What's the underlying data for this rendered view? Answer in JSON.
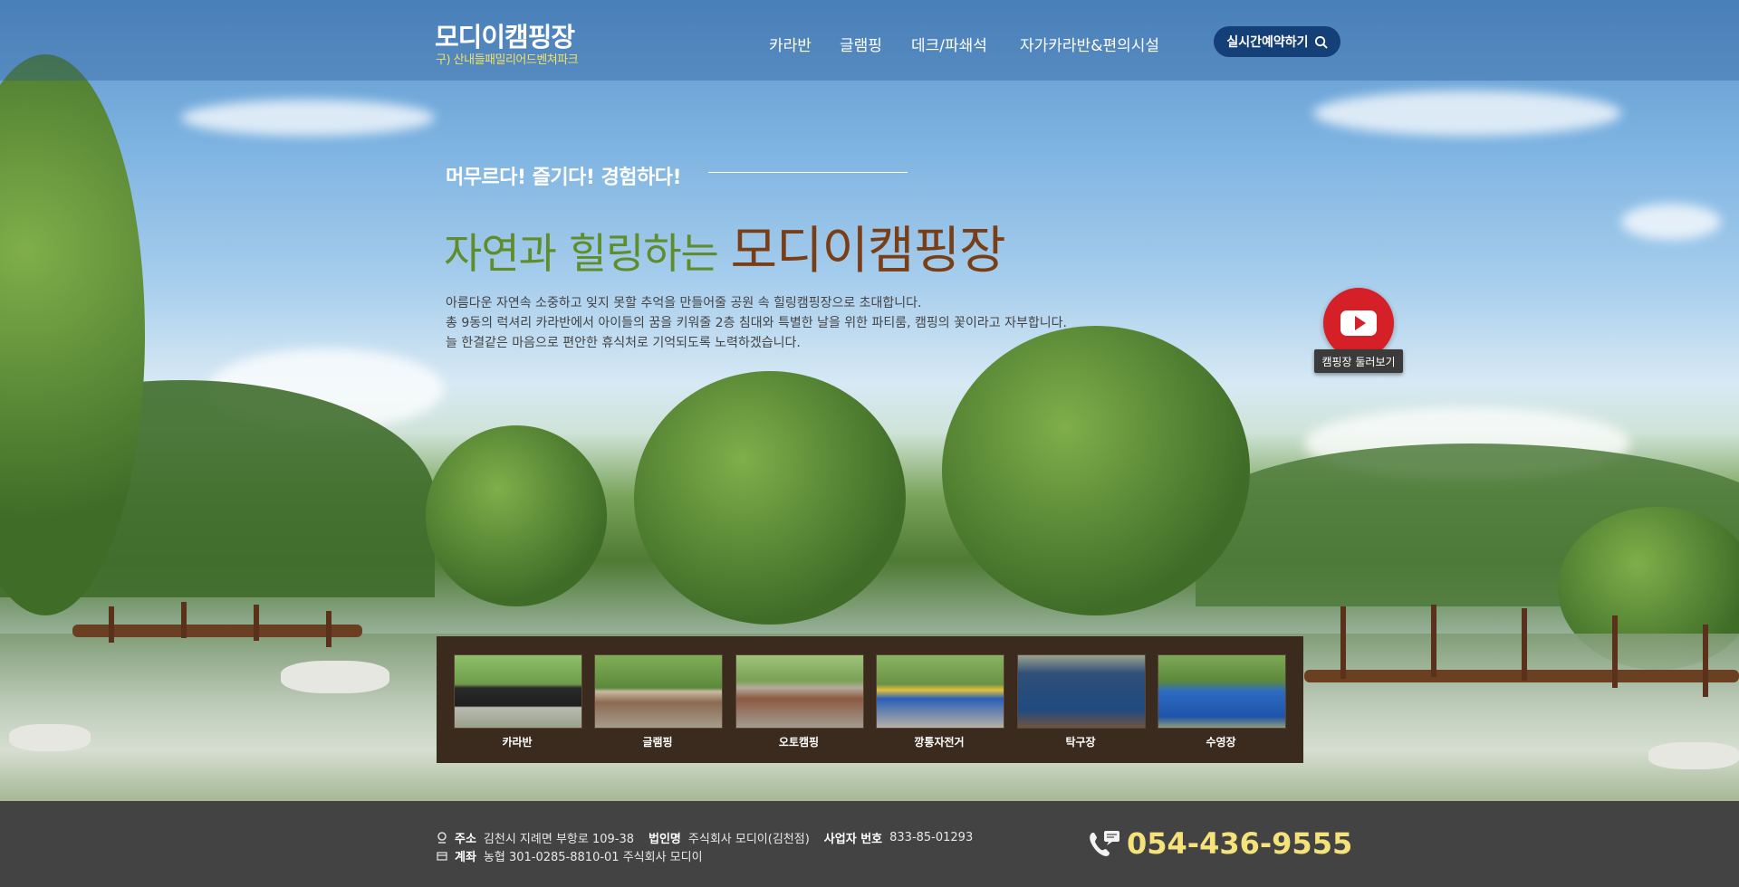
{
  "header": {
    "logo_title": "모디이캠핑장",
    "logo_sub": "구) 산내들패밀리어드벤쳐파크",
    "nav": [
      "카라반",
      "글램핑",
      "데크/파쇄석",
      "자가카라반&편의시설"
    ],
    "reserve_label": "실시간예약하기"
  },
  "intro": {
    "slogan": "머무르다! 즐기다! 경험하다!",
    "title_part1": "자연과 힐링하는",
    "title_part2": "모디이캠핑장",
    "desc_lines": [
      "아름다운 자연속 소중하고 잊지 못할 추억을 만들어줄 공원 속 힐링캠핑장으로 초대합니다.",
      "총 9동의 럭셔리 카라반에서 아이들의 꿈을 키워줄 2층 침대와 특별한 날을 위한 파티룸, 캠핑의 꽃이라고 자부합니다.",
      "늘 한결같은 마음으로 편안한 휴식처로 기억되도록 노력하겠습니다."
    ]
  },
  "video": {
    "label": "캠핑장 둘러보기"
  },
  "facilities": [
    {
      "label": "카라반"
    },
    {
      "label": "글램핑"
    },
    {
      "label": "오토캠핑"
    },
    {
      "label": "깡통자전거"
    },
    {
      "label": "탁구장"
    },
    {
      "label": "수영장"
    }
  ],
  "footer": {
    "address_key": "주소",
    "address_val": "김천시 지례면 부항로 109-38",
    "corp_key": "법인명",
    "corp_val": "주식회사 모디이(김천점)",
    "biz_key": "사업자 번호",
    "biz_val": "833-85-01293",
    "account_key": "계좌",
    "account_val": "농협 301-0285-8810-01 주식회사 모디이",
    "phone": "054-436-9555"
  },
  "colors": {
    "header_button": "#143f77",
    "panel_bg": "#3b2a1e",
    "footer_bg": "#434343",
    "phone": "#f6e27a",
    "youtube": "#d42026"
  }
}
